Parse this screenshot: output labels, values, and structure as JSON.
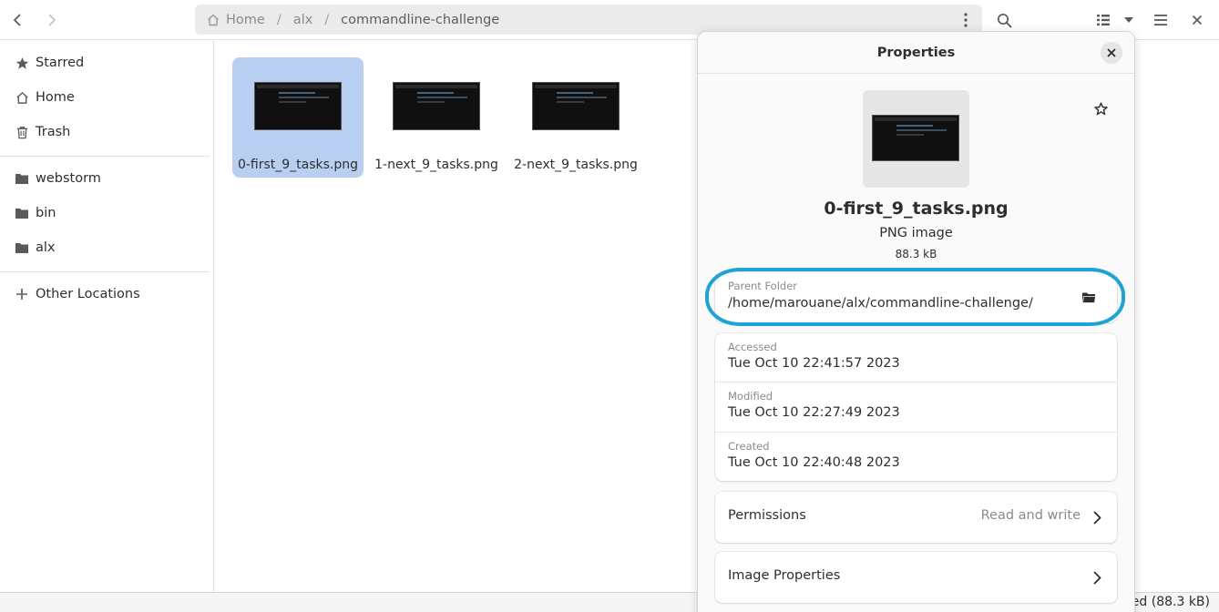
{
  "header": {
    "back_icon": "go-previous-icon",
    "forward_icon": "go-next-icon",
    "path": {
      "home_label": "Home",
      "segment_1": "alx",
      "current": "commandline-challenge",
      "separator": "/"
    },
    "search_icon": "search-icon",
    "view_icon": "list-view-icon",
    "view_dropdown_icon": "pan-down-icon",
    "menu_icon": "hamburger-menu-icon",
    "close_icon": "close-icon"
  },
  "sidebar": {
    "items": [
      {
        "label": "Starred",
        "icon": "star-icon"
      },
      {
        "label": "Home",
        "icon": "home-icon"
      },
      {
        "label": "Trash",
        "icon": "trash-icon"
      },
      {
        "label": "webstorm",
        "icon": "folder-icon"
      },
      {
        "label": "bin",
        "icon": "folder-icon"
      },
      {
        "label": "alx",
        "icon": "folder-icon"
      },
      {
        "label": "Other Locations",
        "icon": "plus-icon"
      }
    ]
  },
  "files": [
    {
      "name": "0-first_9_tasks.png",
      "selected": true
    },
    {
      "name": "1-next_9_tasks.png",
      "selected": false
    },
    {
      "name": "2-next_9_tasks.png",
      "selected": false
    }
  ],
  "status": {
    "text": "ed (88.3 kB)"
  },
  "properties": {
    "title": "Properties",
    "file_name": "0-first_9_tasks.png",
    "file_type": "PNG image",
    "file_size": "88.3 kB",
    "parent_folder_caption": "Parent Folder",
    "parent_folder_value": "/home/marouane/alx/commandline-challenge/",
    "times": [
      {
        "caption": "Accessed",
        "value": "Tue Oct 10 22:41:57 2023"
      },
      {
        "caption": "Modified",
        "value": "Tue Oct 10 22:27:49 2023"
      },
      {
        "caption": "Created",
        "value": "Tue Oct 10 22:40:48 2023"
      }
    ],
    "permissions_label": "Permissions",
    "permissions_value": "Read and write",
    "image_properties_label": "Image Properties"
  },
  "colors": {
    "selection": "#b9cff2",
    "highlight_ring": "#1fa2d4"
  }
}
